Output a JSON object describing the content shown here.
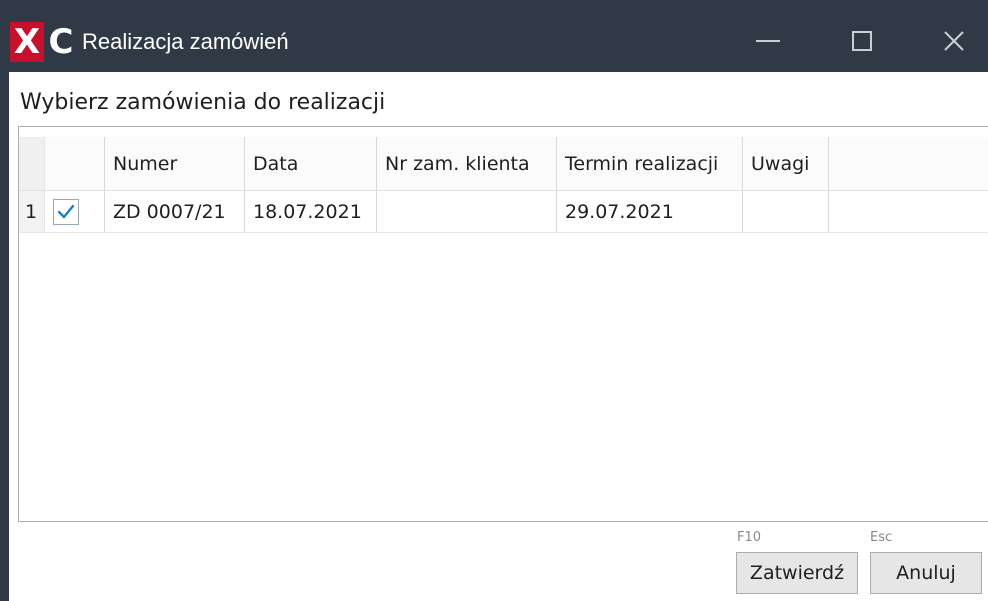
{
  "window": {
    "title": "Realizacja zamówień",
    "logo_left": "X",
    "logo_right": "C"
  },
  "colors": {
    "titlebar": "#2f3a46",
    "logo_red": "#c8102e",
    "check_blue": "#1e7fc4"
  },
  "icons": {
    "minimize": "minimize-icon",
    "maximize": "maximize-icon",
    "close": "close-icon",
    "check": "checkmark-icon"
  },
  "content": {
    "heading": "Wybierz zamówienia do realizacji"
  },
  "table": {
    "columns": [
      "Numer",
      "Data",
      "Nr zam. klienta",
      "Termin realizacji",
      "Uwagi"
    ],
    "rows": [
      {
        "index": "1",
        "checked": true,
        "numer": "ZD 0007/21",
        "data": "18.07.2021",
        "nr_zam_klienta": "",
        "termin_realizacji": "29.07.2021",
        "uwagi": ""
      }
    ]
  },
  "footer": {
    "confirm_shortcut": "F10",
    "confirm_label": "Zatwierdź",
    "cancel_shortcut": "Esc",
    "cancel_label": "Anuluj"
  }
}
